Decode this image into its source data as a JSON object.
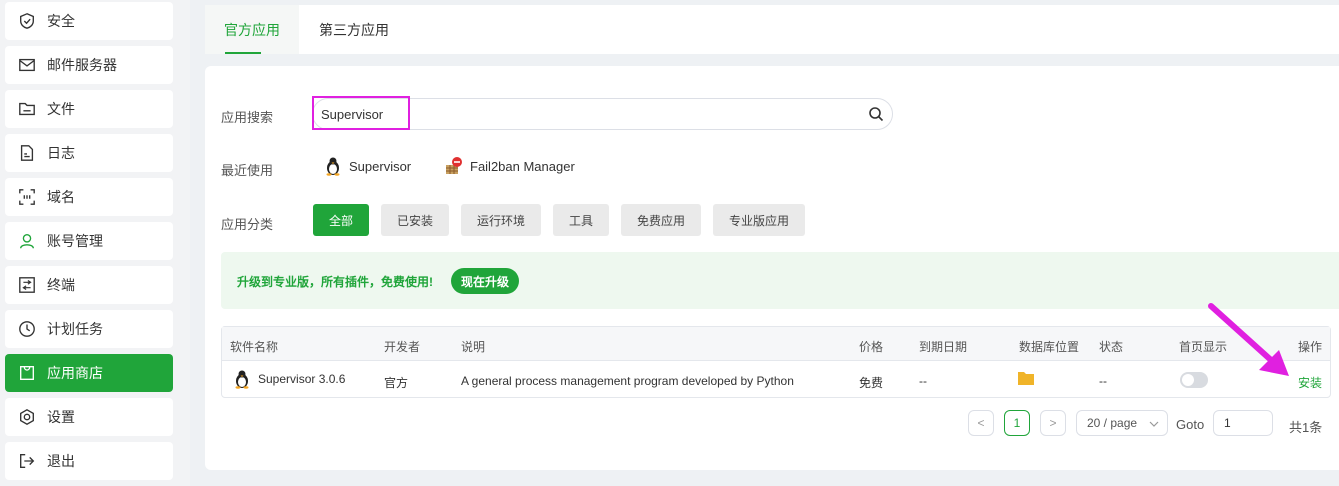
{
  "sidebar": {
    "items": [
      {
        "label": "安全",
        "icon": "shield-icon"
      },
      {
        "label": "邮件服务器",
        "icon": "mail-icon"
      },
      {
        "label": "文件",
        "icon": "folder-icon"
      },
      {
        "label": "日志",
        "icon": "log-icon"
      },
      {
        "label": "域名",
        "icon": "domain-icon"
      },
      {
        "label": "账号管理",
        "icon": "user-icon"
      },
      {
        "label": "终端",
        "icon": "terminal-icon"
      },
      {
        "label": "计划任务",
        "icon": "clock-icon"
      },
      {
        "label": "应用商店",
        "icon": "store-icon",
        "active": true
      },
      {
        "label": "设置",
        "icon": "settings-icon"
      },
      {
        "label": "退出",
        "icon": "logout-icon"
      }
    ]
  },
  "tabs": [
    {
      "label": "官方应用",
      "active": true
    },
    {
      "label": "第三方应用"
    }
  ],
  "search": {
    "label": "应用搜索",
    "value": "Supervisor"
  },
  "recent": {
    "label": "最近使用",
    "items": [
      "Supervisor",
      "Fail2ban Manager"
    ]
  },
  "categories": {
    "label": "应用分类",
    "items": [
      "全部",
      "已安装",
      "运行环境",
      "工具",
      "免费应用",
      "专业版应用"
    ]
  },
  "promo": {
    "text": "升级到专业版，所有插件，免费使用!",
    "button": "现在升级"
  },
  "table": {
    "headers": [
      "软件名称",
      "开发者",
      "说明",
      "价格",
      "到期日期",
      "数据库位置",
      "状态",
      "首页显示",
      "操作"
    ],
    "rows": [
      {
        "name": "Supervisor 3.0.6",
        "developer": "官方",
        "description": "A general process management program developed by Python",
        "price": "免费",
        "expiry": "--",
        "status": "--",
        "homepage_display": false,
        "action": "安装"
      }
    ]
  },
  "pagination": {
    "prev": "<",
    "current": "1",
    "next": ">",
    "page_size": "20 / page",
    "goto_label": "Goto",
    "goto_value": "1",
    "total": "共1条"
  },
  "colors": {
    "accent": "#20a53a",
    "annotation": "#e020e0"
  }
}
